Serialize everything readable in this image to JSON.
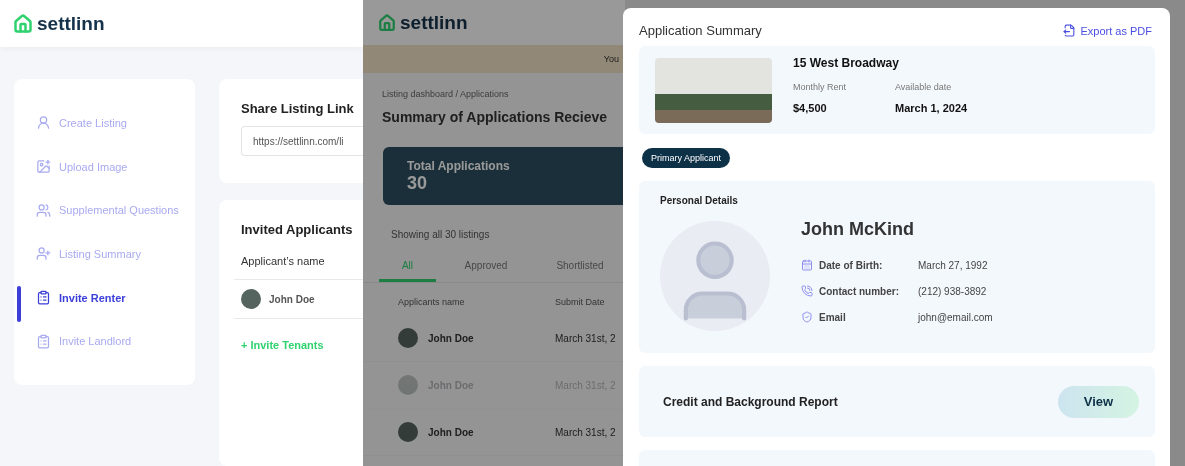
{
  "main_app": {
    "logo": "settlinn",
    "sidebar": [
      {
        "label": "Create Listing",
        "selected": false
      },
      {
        "label": "Upload Image",
        "selected": false
      },
      {
        "label": "Supplemental Questions",
        "selected": false
      },
      {
        "label": "Listing Summary",
        "selected": false
      },
      {
        "label": "Invite Renter",
        "selected": true
      },
      {
        "label": "Invite Landlord",
        "selected": false
      }
    ],
    "share_link": {
      "title": "Share Listing Link",
      "value": "https://settlinn.com/li"
    },
    "invited": {
      "title": "Invited Applicants",
      "column": "Applicant’s name",
      "rows": [
        {
          "name": "John Doe"
        }
      ],
      "invite_action": "+ Invite Tenants"
    }
  },
  "background_page": {
    "logo": "settlinn",
    "banner": "You",
    "breadcrumb": "Listing dashboard / Applications",
    "title": "Summary of Applications Recieve",
    "total": {
      "label": "Total Applications",
      "value": "30"
    },
    "showing": "Showing all 30 listings",
    "tabs": [
      {
        "label": "All",
        "selected": true
      },
      {
        "label": "Approved",
        "selected": false
      },
      {
        "label": "Shortlisted",
        "selected": false
      }
    ],
    "columns": [
      "Applicants name",
      "Submit Date"
    ],
    "rows": [
      {
        "name": "John Doe",
        "date": "March 31st, 2",
        "dimmed": false
      },
      {
        "name": "John Doe",
        "date": "March 31st, 2",
        "dimmed": true
      },
      {
        "name": "John Doe",
        "date": "March 31st, 2",
        "dimmed": false
      }
    ]
  },
  "modal": {
    "title": "Application Summary",
    "export": "Export as PDF",
    "property": {
      "address": "15 West Broadway",
      "facts": [
        {
          "label": "Monthly Rent",
          "value": "$4,500"
        },
        {
          "label": "Available date",
          "value": "March 1, 2024"
        }
      ]
    },
    "badge": "Primary Applicant",
    "personal": {
      "title": "Personal Details",
      "name": "John McKind",
      "details": [
        {
          "kind": "date",
          "label": "Date of Birth:",
          "value": "March 27, 1992"
        },
        {
          "kind": "phone",
          "label": "Contact number:",
          "value": "(212) 938-3892"
        },
        {
          "kind": "email",
          "label": "Email",
          "value": "john@email.com"
        }
      ]
    },
    "report": {
      "title": "Credit and Background Report",
      "action": "View"
    }
  }
}
